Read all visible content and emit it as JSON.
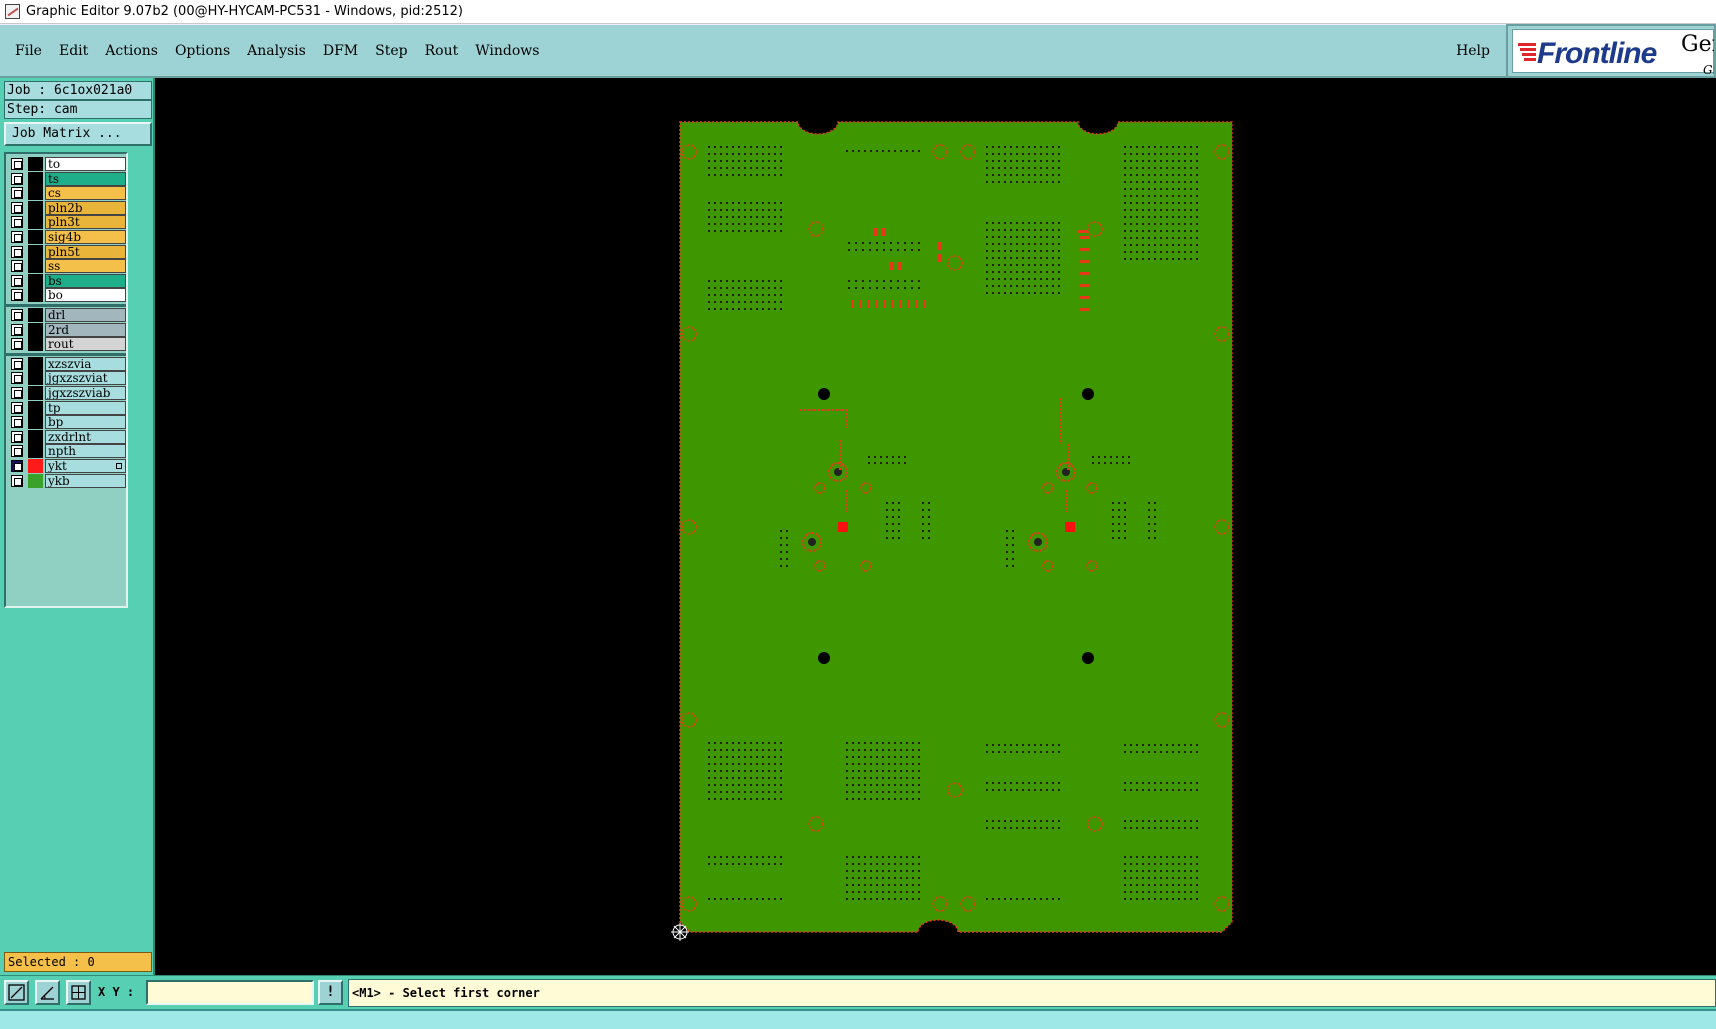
{
  "window": {
    "title": "Graphic Editor 9.07b2 (00@HY-HYCAM-PC531 - Windows, pid:2512)"
  },
  "menubar": {
    "items": [
      {
        "id": "file",
        "label": "File"
      },
      {
        "id": "edit",
        "label": "Edit"
      },
      {
        "id": "actions",
        "label": "Actions"
      },
      {
        "id": "options",
        "label": "Options"
      },
      {
        "id": "analysis",
        "label": "Analysis"
      },
      {
        "id": "dfm",
        "label": "DFM"
      },
      {
        "id": "step",
        "label": "Step"
      },
      {
        "id": "rout",
        "label": "Rout"
      },
      {
        "id": "windows",
        "label": "Windows"
      }
    ],
    "help_label": "Help"
  },
  "logo": {
    "brand": "Frontline",
    "product": "Gen",
    "product_sub": "Gr"
  },
  "left_panel": {
    "job": "Job : 6c1ox021a0",
    "step": "Step: cam",
    "job_matrix_label": "Job Matrix ...",
    "selected": "Selected : 0"
  },
  "layers": {
    "board": [
      {
        "name": "to",
        "color": "#ffffff"
      },
      {
        "name": "ts",
        "color": "#1fae8a"
      },
      {
        "name": "cs",
        "color": "#f5c04a"
      },
      {
        "name": "pln2b",
        "color": "#e9b43a"
      },
      {
        "name": "pln3t",
        "color": "#e9b43a"
      },
      {
        "name": "sig4b",
        "color": "#f5c04a"
      },
      {
        "name": "pln5t",
        "color": "#e9b43a"
      },
      {
        "name": "ss",
        "color": "#f5c04a"
      },
      {
        "name": "bs",
        "color": "#1fae8a"
      },
      {
        "name": "bo",
        "color": "#ffffff"
      }
    ],
    "drill": [
      {
        "name": "drl",
        "color": "#a2b6bd"
      },
      {
        "name": "2rd",
        "color": "#a2b6bd"
      },
      {
        "name": "rout",
        "color": "#d4d4d4"
      }
    ],
    "misc": [
      {
        "name": "xzszvia",
        "color": "#a7ddde"
      },
      {
        "name": "jgxzszviat",
        "color": "#a7ddde"
      },
      {
        "name": "jgxzszviab",
        "color": "#a7ddde"
      },
      {
        "name": "tp",
        "color": "#a7ddde"
      },
      {
        "name": "bp",
        "color": "#a7ddde"
      },
      {
        "name": "zxdrlnt",
        "color": "#a7ddde"
      },
      {
        "name": "npth",
        "color": "#a7ddde"
      },
      {
        "name": "ykt",
        "color": "#a7ddde",
        "active": true,
        "swatch": "#ff1a1a"
      },
      {
        "name": "ykb",
        "color": "#a7ddde",
        "swatch": "#3aa12a"
      }
    ]
  },
  "command_bar": {
    "xy_label": "X Y :",
    "xy_value": "",
    "excl_label": "!",
    "prompt": "<M1> - Select first corner"
  },
  "colors": {
    "board_green": "#3f9700",
    "pad_red": "#e8371b",
    "background": "#000000"
  }
}
